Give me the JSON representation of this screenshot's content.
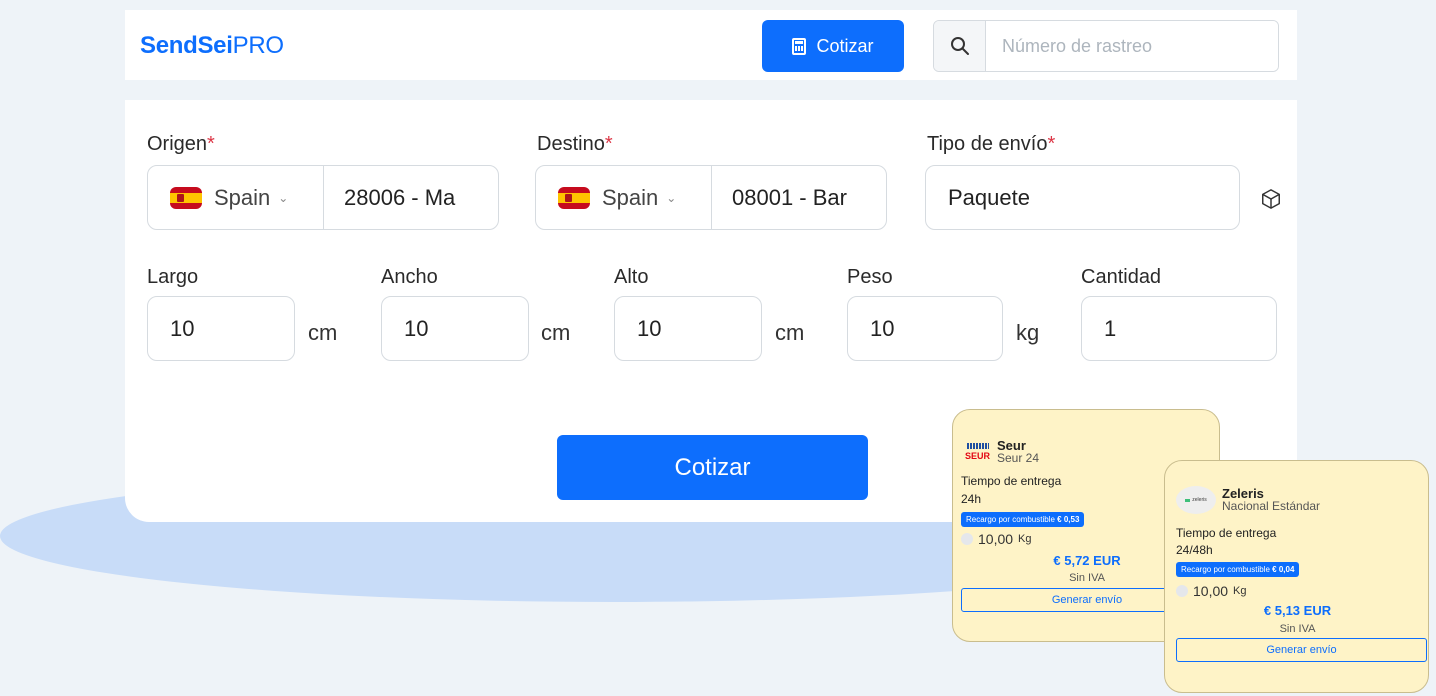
{
  "brand": {
    "bold": "SendSei",
    "light": "PRO"
  },
  "header": {
    "cotizar_label": "Cotizar",
    "search_placeholder": "Número de rastreo",
    "search_value": ""
  },
  "form": {
    "origen": {
      "label": "Origen",
      "required": "*",
      "country": "Spain",
      "postal": "28006 - Ma"
    },
    "destino": {
      "label": "Destino",
      "required": "*",
      "country": "Spain",
      "postal": "08001 - Bar"
    },
    "tipo": {
      "label": "Tipo de envío",
      "required": "*",
      "value": "Paquete"
    },
    "largo": {
      "label": "Largo",
      "value": "10",
      "unit": "cm"
    },
    "ancho": {
      "label": "Ancho",
      "value": "10",
      "unit": "cm"
    },
    "alto": {
      "label": "Alto",
      "value": "10",
      "unit": "cm"
    },
    "peso": {
      "label": "Peso",
      "value": "10",
      "unit": "kg"
    },
    "cantidad": {
      "label": "Cantidad",
      "value": "1"
    },
    "submit_label": "Cotizar"
  },
  "quotes": [
    {
      "logo_text": "SEUR",
      "carrier": "Seur",
      "service": "Seur 24",
      "delivery_label": "Tiempo de entrega",
      "delivery_value": "24h",
      "surcharge_label": "Recargo por combustible",
      "surcharge_value": "€ 0,53",
      "weight": "10,00",
      "weight_unit": "Kg",
      "price": "€ 5,72 EUR",
      "tax_note": "Sin IVA",
      "action_label": "Generar envío"
    },
    {
      "logo_text": "zeleris",
      "carrier": "Zeleris",
      "service": "Nacional Estándar",
      "delivery_label": "Tiempo de entrega",
      "delivery_value": "24/48h",
      "surcharge_label": "Recargo por combustible",
      "surcharge_value": "€ 0,04",
      "weight": "10,00",
      "weight_unit": "Kg",
      "price": "€ 5,13 EUR",
      "tax_note": "Sin IVA",
      "action_label": "Generar envío"
    }
  ],
  "colors": {
    "primary": "#0d6efd",
    "required": "#dc3545",
    "quote_bg": "#fef3c7",
    "background": "#eef3f8",
    "accent_shape": "#c8dcf8"
  },
  "icons": [
    "calculator-icon",
    "search-icon",
    "spain-flag-icon",
    "chevron-down-icon",
    "package-box-icon"
  ]
}
